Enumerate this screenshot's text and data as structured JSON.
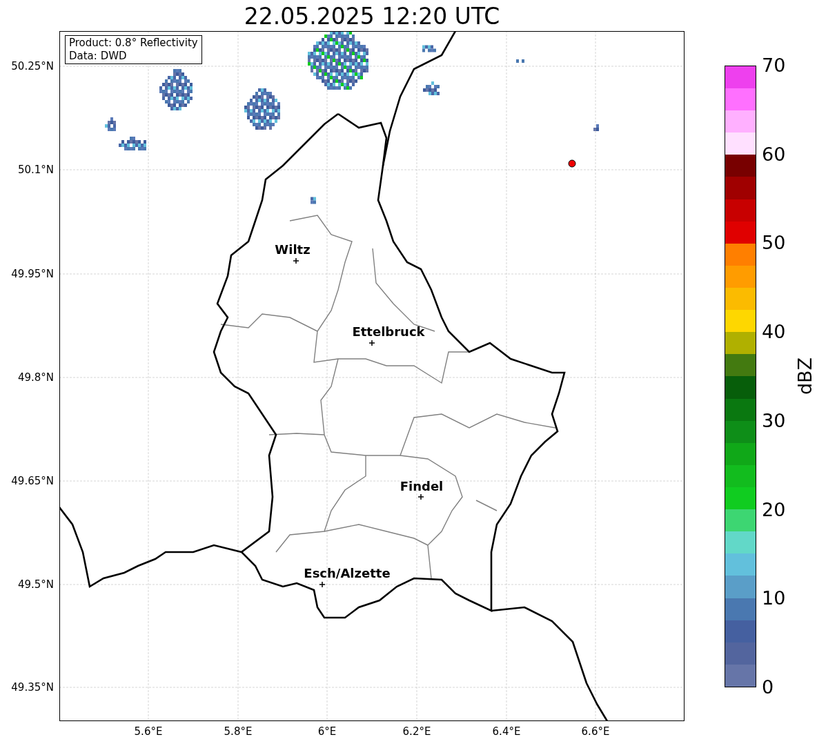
{
  "title": "22.05.2025 12:20 UTC",
  "info_box": {
    "lines": [
      "Product: 0.8° Reflectivity",
      "Data: DWD"
    ]
  },
  "y_ticks": [
    "50.25°N",
    "50.1°N",
    "49.95°N",
    "49.8°N",
    "49.65°N",
    "49.5°N",
    "49.35°N"
  ],
  "x_ticks": [
    "5.6°E",
    "5.8°E",
    "6°E",
    "6.2°E",
    "6.4°E",
    "6.6°E"
  ],
  "cities": [
    {
      "name": "Wiltz"
    },
    {
      "name": "Ettelbruck"
    },
    {
      "name": "Findel"
    },
    {
      "name": "Esch/Alzette"
    }
  ],
  "colorbar": {
    "label": "dBZ",
    "ticks": [
      "70",
      "60",
      "50",
      "40",
      "30",
      "20",
      "10",
      "0"
    ],
    "bins": [
      {
        "color": "#6675a8"
      },
      {
        "color": "#53659e"
      },
      {
        "color": "#4560a0"
      },
      {
        "color": "#4a78b0"
      },
      {
        "color": "#5a9ec8"
      },
      {
        "color": "#62c0dc"
      },
      {
        "color": "#62d8c8"
      },
      {
        "color": "#3dd672"
      },
      {
        "color": "#10cc20"
      },
      {
        "color": "#12bc1e"
      },
      {
        "color": "#10a818"
      },
      {
        "color": "#0e8e18"
      },
      {
        "color": "#0a7810"
      },
      {
        "color": "#075e0a"
      },
      {
        "color": "#437a10"
      },
      {
        "color": "#b0b000"
      },
      {
        "color": "#fed700"
      },
      {
        "color": "#fbbb00"
      },
      {
        "color": "#ff9c00"
      },
      {
        "color": "#ff7f00"
      },
      {
        "color": "#e00000"
      },
      {
        "color": "#c80000"
      },
      {
        "color": "#a00000"
      },
      {
        "color": "#780000"
      },
      {
        "color": "#ffe0ff"
      },
      {
        "color": "#ffb0ff"
      },
      {
        "color": "#ff70ff"
      },
      {
        "color": "#ee40ee"
      }
    ]
  }
}
